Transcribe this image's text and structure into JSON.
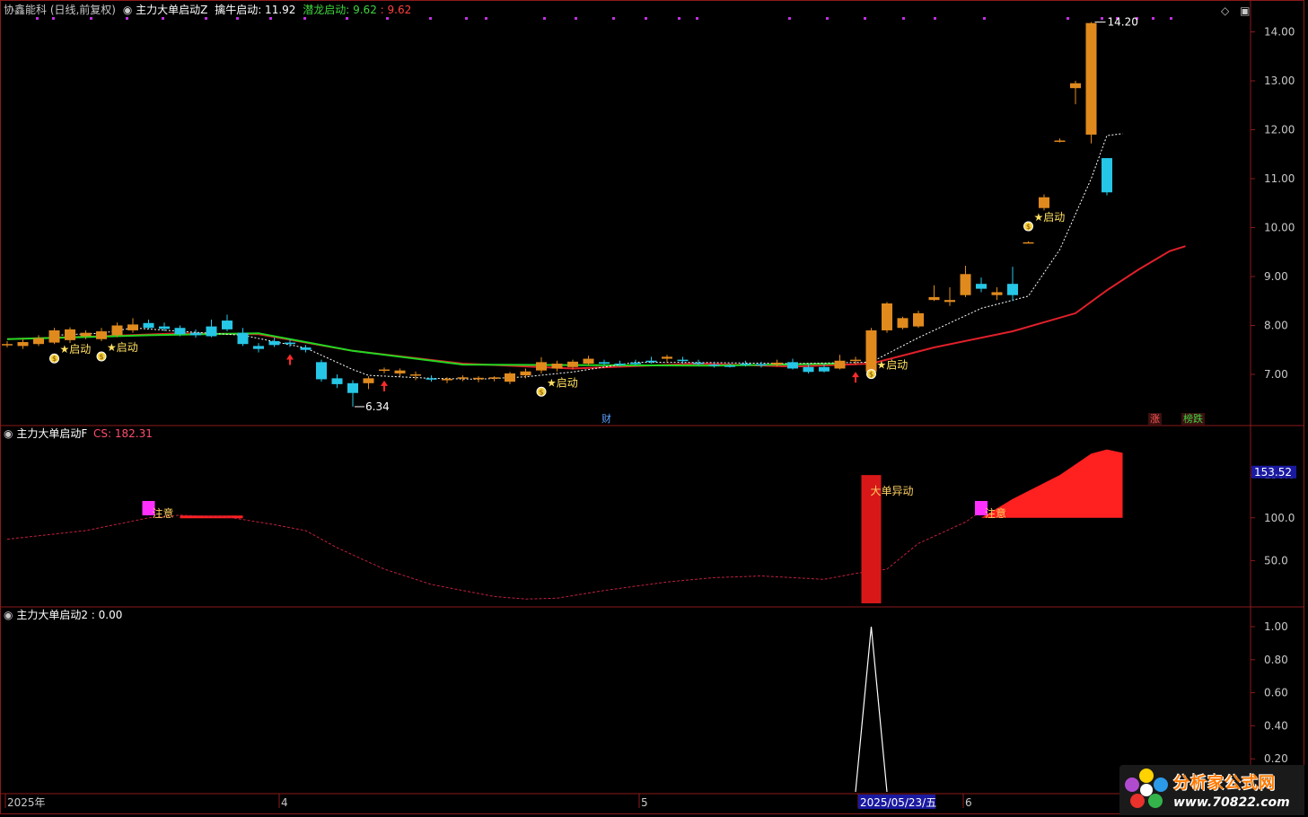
{
  "header": {
    "stock": "协鑫能科 (日线,前复权)",
    "indicator": "主力大单启动Z",
    "qinniu_label": "擒牛启动: 11.92",
    "qianlong_label": "潜龙启动: 9.62",
    "qianlong_value": ": 9.62"
  },
  "panel2_header": {
    "name": "主力大单启动F",
    "cs": "CS: 182.31"
  },
  "panel3_header": {
    "name": "主力大单启动2 : 0.00"
  },
  "x_axis": {
    "labels": [
      "2025年",
      "4",
      "5",
      "2025/05/23/五",
      "6"
    ]
  },
  "badges": {
    "cai": "财",
    "zhang": "涨",
    "bangdie": "榜跌"
  },
  "logo": {
    "title": "分析家公式网",
    "url": "www.70822.com"
  },
  "colors": {
    "up": "#e08a1e",
    "down": "#26c6e6",
    "ma_red": "#e0202a",
    "ma_green": "#22d822",
    "signal_line": "#ffffff",
    "area": "#ff2020"
  },
  "chart_data": [
    {
      "type": "candlestick",
      "title": "协鑫能科 (日线,前复权)",
      "ylim": [
        6.0,
        14.4
      ],
      "yticks": [
        7.0,
        8.0,
        9.0,
        10.0,
        11.0,
        12.0,
        13.0,
        14.0
      ],
      "max_label": "14.20",
      "min_label": "6.34",
      "candles": [
        [
          7.6,
          7.68,
          7.55,
          7.62
        ],
        [
          7.58,
          7.72,
          7.52,
          7.66
        ],
        [
          7.62,
          7.8,
          7.58,
          7.74
        ],
        [
          7.65,
          7.95,
          7.62,
          7.9
        ],
        [
          7.7,
          7.96,
          7.64,
          7.92
        ],
        [
          7.78,
          7.9,
          7.72,
          7.85
        ],
        [
          7.72,
          7.95,
          7.68,
          7.88
        ],
        [
          7.8,
          8.06,
          7.76,
          8.0
        ],
        [
          7.9,
          8.15,
          7.85,
          8.02
        ],
        [
          8.05,
          8.12,
          7.92,
          7.95
        ],
        [
          7.98,
          8.06,
          7.88,
          7.93
        ],
        [
          7.95,
          8.0,
          7.78,
          7.82
        ],
        [
          7.85,
          7.92,
          7.75,
          7.8
        ],
        [
          7.98,
          8.12,
          7.76,
          7.78
        ],
        [
          8.1,
          8.22,
          7.88,
          7.92
        ],
        [
          7.85,
          7.95,
          7.58,
          7.62
        ],
        [
          7.58,
          7.64,
          7.45,
          7.52
        ],
        [
          7.68,
          7.75,
          7.56,
          7.6
        ],
        [
          7.65,
          7.72,
          7.56,
          7.62
        ],
        [
          7.55,
          7.6,
          7.45,
          7.5
        ],
        [
          7.25,
          7.3,
          6.85,
          6.9
        ],
        [
          6.92,
          7.0,
          6.72,
          6.8
        ],
        [
          6.82,
          6.88,
          6.34,
          6.62
        ],
        [
          6.82,
          6.96,
          6.7,
          6.92
        ],
        [
          7.08,
          7.14,
          7.02,
          7.1
        ],
        [
          7.02,
          7.12,
          6.96,
          7.08
        ],
        [
          6.98,
          7.06,
          6.88,
          7.0
        ],
        [
          6.92,
          6.98,
          6.85,
          6.9
        ],
        [
          6.88,
          6.94,
          6.82,
          6.91
        ],
        [
          6.92,
          6.98,
          6.86,
          6.94
        ],
        [
          6.9,
          6.96,
          6.84,
          6.93
        ],
        [
          6.92,
          6.96,
          6.86,
          6.94
        ],
        [
          6.85,
          7.05,
          6.8,
          7.02
        ],
        [
          6.98,
          7.12,
          6.92,
          7.06
        ],
        [
          7.08,
          7.35,
          7.02,
          7.25
        ],
        [
          7.12,
          7.28,
          7.06,
          7.22
        ],
        [
          7.15,
          7.3,
          7.1,
          7.26
        ],
        [
          7.22,
          7.38,
          7.18,
          7.32
        ],
        [
          7.25,
          7.3,
          7.18,
          7.22
        ],
        [
          7.22,
          7.28,
          7.16,
          7.2
        ],
        [
          7.24,
          7.3,
          7.18,
          7.21
        ],
        [
          7.28,
          7.36,
          7.22,
          7.26
        ],
        [
          7.32,
          7.4,
          7.26,
          7.36
        ],
        [
          7.3,
          7.36,
          7.22,
          7.28
        ],
        [
          7.24,
          7.3,
          7.18,
          7.22
        ],
        [
          7.2,
          7.26,
          7.14,
          7.18
        ],
        [
          7.18,
          7.22,
          7.14,
          7.16
        ],
        [
          7.22,
          7.28,
          7.16,
          7.2
        ],
        [
          7.21,
          7.26,
          7.14,
          7.19
        ],
        [
          7.2,
          7.3,
          7.16,
          7.24
        ],
        [
          7.25,
          7.32,
          7.1,
          7.12
        ],
        [
          7.15,
          7.22,
          7.02,
          7.05
        ],
        [
          7.15,
          7.22,
          7.04,
          7.06
        ],
        [
          7.12,
          7.4,
          7.1,
          7.28
        ],
        [
          7.28,
          7.36,
          7.2,
          7.3
        ],
        [
          7.05,
          7.95,
          7.02,
          7.9
        ],
        [
          7.9,
          8.48,
          7.85,
          8.45
        ],
        [
          7.95,
          8.18,
          7.92,
          8.15
        ],
        [
          7.98,
          8.3,
          7.95,
          8.25
        ],
        [
          8.52,
          8.82,
          8.5,
          8.58
        ],
        [
          8.48,
          8.78,
          8.4,
          8.52
        ],
        [
          8.62,
          9.22,
          8.58,
          9.05
        ],
        [
          8.85,
          8.98,
          8.68,
          8.75
        ],
        [
          8.62,
          8.78,
          8.52,
          8.68
        ],
        [
          8.85,
          9.2,
          8.5,
          8.62
        ],
        [
          9.7,
          9.72,
          9.68,
          9.7
        ],
        [
          10.4,
          10.68,
          10.35,
          10.62
        ],
        [
          11.78,
          11.82,
          11.74,
          11.78
        ],
        [
          12.85,
          13.0,
          12.52,
          12.95
        ],
        [
          11.9,
          14.2,
          11.72,
          14.18
        ],
        [
          11.42,
          11.42,
          10.66,
          10.72
        ]
      ],
      "ma_red": [
        [
          0,
          7.72
        ],
        [
          6,
          7.78
        ],
        [
          11,
          7.84
        ],
        [
          16,
          7.82
        ],
        [
          22,
          7.48
        ],
        [
          29,
          7.22
        ],
        [
          36,
          7.12
        ],
        [
          44,
          7.22
        ],
        [
          50,
          7.16
        ],
        [
          55,
          7.22
        ],
        [
          59,
          7.55
        ],
        [
          64,
          7.88
        ],
        [
          68,
          8.25
        ],
        [
          70,
          8.72
        ],
        [
          72,
          9.14
        ],
        [
          74,
          9.52
        ],
        [
          75,
          9.62
        ]
      ],
      "ma_green": [
        [
          0,
          7.72
        ],
        [
          9,
          7.8
        ],
        [
          16,
          7.84
        ],
        [
          22,
          7.48
        ],
        [
          29,
          7.2
        ],
        [
          45,
          7.18
        ],
        [
          53,
          7.22
        ]
      ],
      "signal_dashed": [
        [
          3,
          7.8
        ],
        [
          6,
          7.84
        ],
        [
          8,
          7.95
        ],
        [
          11,
          7.88
        ],
        [
          15,
          7.8
        ],
        [
          19,
          7.54
        ],
        [
          22,
          7.1
        ],
        [
          23,
          6.98
        ],
        [
          27,
          6.92
        ],
        [
          30,
          6.9
        ],
        [
          33,
          6.95
        ],
        [
          36,
          7.05
        ],
        [
          40,
          7.25
        ],
        [
          45,
          7.24
        ],
        [
          50,
          7.22
        ],
        [
          55,
          7.25
        ],
        [
          58,
          7.75
        ],
        [
          62,
          8.35
        ],
        [
          65,
          8.6
        ],
        [
          67,
          9.55
        ],
        [
          69,
          11.0
        ],
        [
          70,
          11.88
        ],
        [
          71,
          11.92
        ]
      ],
      "qidong_signals": [
        [
          3,
          "★启动"
        ],
        [
          6,
          "★启动"
        ],
        [
          34,
          "★启动"
        ],
        [
          55,
          "★启动"
        ],
        [
          65,
          "★启动"
        ]
      ],
      "up_arrows": [
        18,
        24,
        54
      ],
      "qidong_marker_y": [
        7.62,
        7.66,
        6.94,
        7.3,
        10.32
      ]
    },
    {
      "type": "line",
      "title": "主力大单启动F",
      "ylim": [
        0,
        190
      ],
      "yticks": [
        50.0,
        100.0,
        150.0
      ],
      "current_label": "153.52",
      "line": [
        [
          0,
          75
        ],
        [
          5,
          85
        ],
        [
          9,
          100
        ],
        [
          11,
          103
        ],
        [
          14,
          101
        ],
        [
          17,
          92
        ],
        [
          19,
          85
        ],
        [
          21,
          65
        ],
        [
          24,
          40
        ],
        [
          27,
          22
        ],
        [
          31,
          8
        ],
        [
          33,
          5
        ],
        [
          35,
          6
        ],
        [
          38,
          15
        ],
        [
          42,
          25
        ],
        [
          45,
          30
        ],
        [
          48,
          32
        ],
        [
          50,
          30
        ],
        [
          52,
          28
        ],
        [
          54,
          35
        ],
        [
          56,
          40
        ],
        [
          58,
          70
        ],
        [
          61,
          95
        ],
        [
          62,
          108
        ]
      ],
      "magenta_marks": [
        [
          9,
          105,
          "注意"
        ],
        [
          62,
          105,
          "注意"
        ]
      ],
      "big_bar": {
        "x": 55,
        "top": 150,
        "bottom": 0,
        "label": "大单异动"
      },
      "area": [
        [
          62,
          100
        ],
        [
          64,
          122
        ],
        [
          67,
          150
        ],
        [
          69,
          175
        ],
        [
          70,
          180
        ],
        [
          71,
          176
        ]
      ]
    },
    {
      "type": "line",
      "title": "主力大单启动2",
      "ylim": [
        0,
        1.1
      ],
      "yticks": [
        0.2,
        0.4,
        0.6,
        0.8,
        1.0
      ],
      "spike": [
        [
          54,
          0
        ],
        [
          55,
          1.0
        ],
        [
          56,
          0
        ]
      ]
    }
  ]
}
